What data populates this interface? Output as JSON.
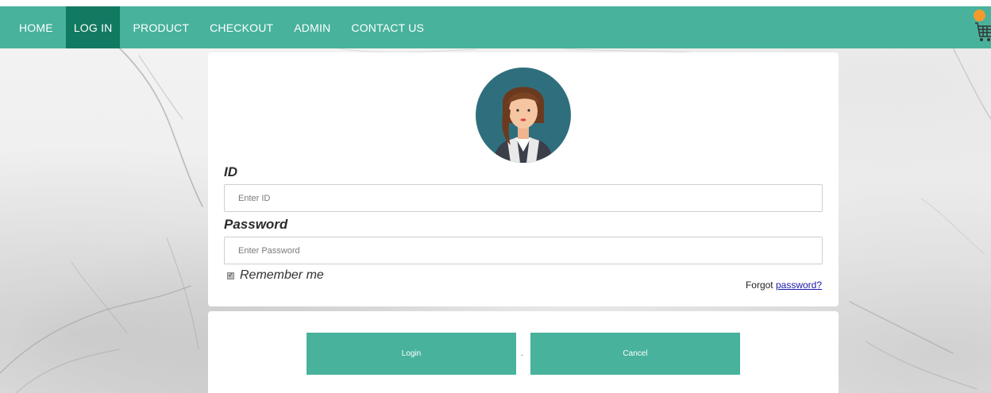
{
  "nav": {
    "items": [
      {
        "label": "HOME",
        "active": false
      },
      {
        "label": "LOG IN",
        "active": true
      },
      {
        "label": "PRODUCT",
        "active": false
      },
      {
        "label": "CHECKOUT",
        "active": false
      },
      {
        "label": "ADMIN",
        "active": false
      },
      {
        "label": "CONTACT US",
        "active": false
      }
    ],
    "cart_icon": "shopping-cart-icon"
  },
  "login": {
    "avatar_icon": "user-avatar-icon",
    "id_label": "ID",
    "id_placeholder": "Enter ID",
    "id_value": "",
    "password_label": "Password",
    "password_placeholder": "Enter Password",
    "password_value": "",
    "remember_label": "Remember me",
    "remember_checked": true,
    "forgot_prefix": "Forgot",
    "forgot_link": "password?"
  },
  "actions": {
    "login_label": "Login",
    "separator": "-",
    "cancel_label": "Cancel"
  },
  "colors": {
    "nav_bg": "#48b29c",
    "nav_active": "#137a62",
    "button_bg": "#48b29c",
    "cart_badge": "#f39a2e",
    "link": "#1a1aa6"
  }
}
